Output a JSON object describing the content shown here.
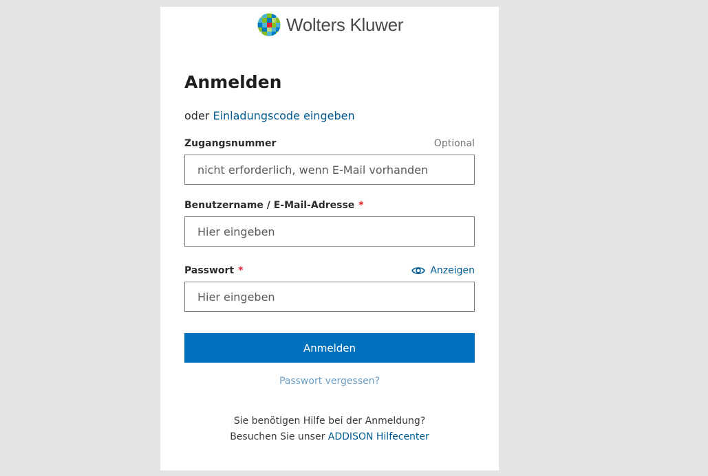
{
  "brand": {
    "logo_text": "Wolters Kluwer",
    "logo_icon": "wolters-kluwer-globe-icon"
  },
  "form": {
    "title": "Anmelden",
    "invite_prefix": "oder",
    "invite_link": "Einladungscode eingeben",
    "access_number": {
      "label": "Zugangsnummer",
      "optional_label": "Optional",
      "placeholder": "nicht erforderlich, wenn E-Mail vorhanden"
    },
    "username": {
      "label": "Benutzername / E-Mail-Adresse",
      "required_mark": "*",
      "placeholder": "Hier eingeben"
    },
    "password": {
      "label": "Passwort",
      "required_mark": "*",
      "placeholder": "Hier eingeben",
      "show_label": "Anzeigen",
      "show_icon": "eye-icon"
    },
    "submit_label": "Anmelden",
    "forgot_link": "Passwort vergessen?"
  },
  "help": {
    "line1": "Sie benötigen Hilfe bei der Anmeldung?",
    "line2_prefix": "Besuchen Sie unser",
    "line2_link": "ADDISON Hilfecenter"
  },
  "colors": {
    "background": "#e4e4e4",
    "card": "#ffffff",
    "primary_button": "#0071bd",
    "link": "#005b92",
    "required": "#e5202e"
  }
}
